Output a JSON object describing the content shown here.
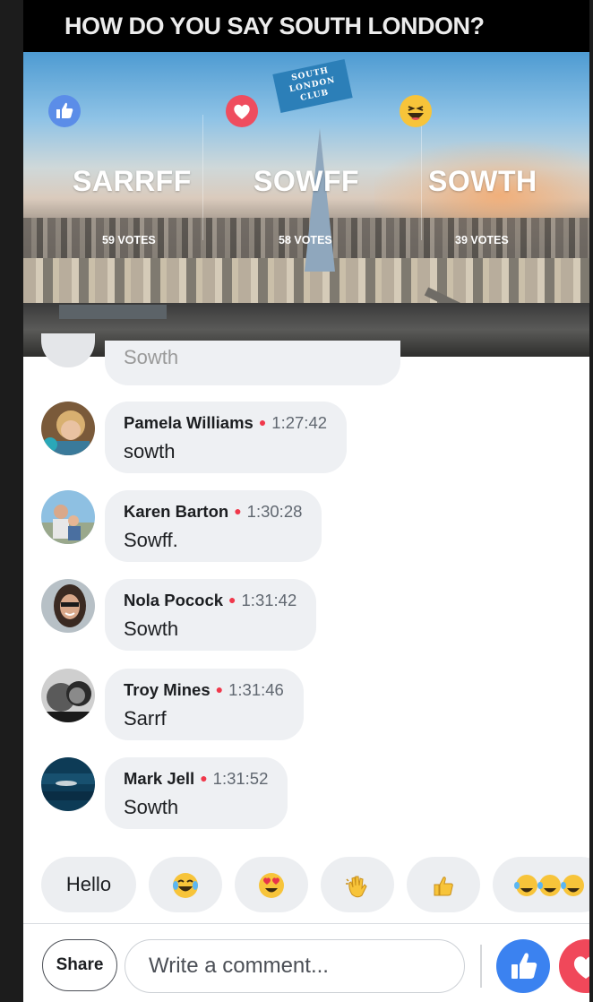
{
  "video": {
    "title": "HOW DO YOU SAY SOUTH LONDON?",
    "logo": {
      "line1": "SOUTH",
      "line2": "LONDON",
      "line3": "CLUB"
    },
    "options": [
      {
        "name": "SARRFF",
        "votes": "59 VOTES",
        "reaction_icon": "like-icon"
      },
      {
        "name": "SOWFF",
        "votes": "58 VOTES",
        "reaction_icon": "love-icon"
      },
      {
        "name": "SOWTH",
        "votes": "39 VOTES",
        "reaction_icon": "haha-icon"
      }
    ]
  },
  "comments": {
    "partial_text": "Sowth",
    "items": [
      {
        "name": "Pamela Williams",
        "time": "1:27:42",
        "text": "sowth"
      },
      {
        "name": "Karen Barton",
        "time": "1:30:28",
        "text": "Sowff."
      },
      {
        "name": "Nola Pocock",
        "time": "1:31:42",
        "text": "Sowth"
      },
      {
        "name": "Troy Mines",
        "time": "1:31:46",
        "text": "Sarrf"
      },
      {
        "name": "Mark Jell",
        "time": "1:31:52",
        "text": "Sowth"
      }
    ]
  },
  "quick_replies": {
    "hello": "Hello",
    "emoji": [
      "tears-of-joy-emoji",
      "heart-eyes-emoji",
      "waving-hand-emoji",
      "thumbs-up-emoji",
      "triple-tears-of-joy-emoji"
    ]
  },
  "composer": {
    "share_label": "Share",
    "placeholder": "Write a comment..."
  },
  "colors": {
    "like_blue": "#3b82f0",
    "love_red": "#f0485a",
    "live_dot": "#f0384b",
    "bubble_bg": "#eef0f3"
  }
}
